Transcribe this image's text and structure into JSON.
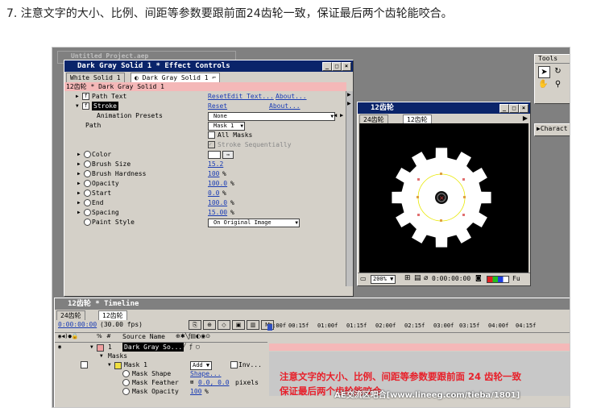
{
  "heading": "7. 注意文字的大小、比例、间距等参数要跟前面24齿轮一致，保证最后两个齿轮能咬合。",
  "effect_controls": {
    "title": "Dark Gray Solid 1 * Effect Controls",
    "bg_title": "Untitled Project.aep",
    "tabs": [
      "White Solid 1",
      "Dark Gray Solid 1"
    ],
    "layer_path": "12齿轮 * Dark Gray Solid 1",
    "path_text": {
      "label": "Path Text",
      "reset": "Reset",
      "edit": "Edit Text...",
      "about": "About..."
    },
    "stroke": {
      "label": "Stroke",
      "reset": "Reset",
      "about": "About..."
    },
    "animation_presets": {
      "label": "Animation Presets",
      "value": "None"
    },
    "path": {
      "label": "Path",
      "value": "Mask 1"
    },
    "all_masks": "All Masks",
    "stroke_sequentially": "Stroke Sequentially",
    "params": [
      {
        "label": "Color",
        "value": ""
      },
      {
        "label": "Brush Size",
        "value": "15.2",
        "unit": ""
      },
      {
        "label": "Brush Hardness",
        "value": "100",
        "unit": "%"
      },
      {
        "label": "Opacity",
        "value": "100.0",
        "unit": "%"
      },
      {
        "label": "Start",
        "value": "0.0",
        "unit": "%"
      },
      {
        "label": "End",
        "value": "100.0",
        "unit": "%"
      },
      {
        "label": "Spacing",
        "value": "15.00",
        "unit": "%"
      }
    ],
    "paint_style": {
      "label": "Paint Style",
      "value": "On Original Image"
    }
  },
  "comp": {
    "title": "12齿轮",
    "tabs": [
      "24齿轮",
      "12齿轮"
    ],
    "zoom": "200%",
    "timecode": "0:00:00:00",
    "quality": "Fu"
  },
  "tools": {
    "title": "Tools"
  },
  "character": {
    "title": "Charact"
  },
  "timeline": {
    "title": "12齿轮 * Timeline",
    "tabs": [
      "24齿轮",
      "12齿轮"
    ],
    "timecode": "0:00:00:00",
    "fps": "(30.00 fps)",
    "col_header": "Source Name",
    "ruler": [
      "0:00f",
      "00:15f",
      "01:00f",
      "01:15f",
      "02:00f",
      "02:15f",
      "03:00f",
      "03:15f",
      "04:00f",
      "04:15f"
    ],
    "layer_num": "1",
    "layer_name": "Dark Gray So...",
    "masks_label": "Masks",
    "mask1": {
      "label": "Mask 1",
      "mode": "Add",
      "inv": "Inv..."
    },
    "mask_shape": {
      "label": "Mask Shape",
      "value": "Shape..."
    },
    "mask_feather": {
      "label": "Mask Feather",
      "value": "0.0, 0.0",
      "unit": "pixels"
    },
    "mask_opacity": {
      "label": "Mask Opacity",
      "value": "100",
      "unit": "%"
    }
  },
  "overlay": {
    "line1": "注意文字的大小、比例、间距等参数要跟前面 24 齿轮一致",
    "line2": "保证最后两个齿轮能咬合",
    "watermark": "AE交流区吧合[www.lineeg.com/tieba/1801]"
  },
  "colors": {
    "titlebar": "#0a246a",
    "accent_red": "#e8202a",
    "link": "#1a3cb4",
    "pink": "#f4b8b8"
  }
}
